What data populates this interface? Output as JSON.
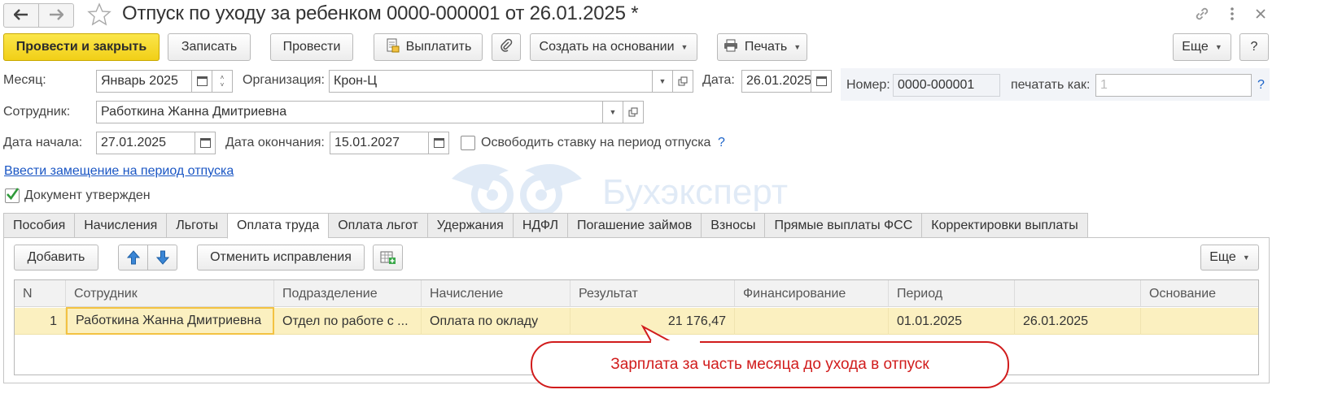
{
  "window": {
    "title": "Отпуск по уходу за ребенком 0000-000001 от 26.01.2025 *",
    "back_icon": "arrow-left-icon",
    "forward_icon": "arrow-right-icon",
    "favorite_icon": "star-icon",
    "link_icon": "link-icon",
    "more_icon": "more-vertical-icon",
    "close_icon": "close-icon"
  },
  "toolbar": {
    "post_close": "Провести и закрыть",
    "save": "Записать",
    "post": "Провести",
    "pay": "Выплатить",
    "create_based": "Создать на основании",
    "print": "Печать",
    "more": "Еще",
    "help": "?"
  },
  "form": {
    "month_label": "Месяц:",
    "month_value": "Январь 2025",
    "org_label": "Организация:",
    "org_value": "Крон-Ц",
    "date_label": "Дата:",
    "date_value": "26.01.2025",
    "number_label": "Номер:",
    "number_value": "0000-000001",
    "print_as_label": "печатать как:",
    "print_as_placeholder": "1",
    "print_as_help": "?",
    "employee_label": "Сотрудник:",
    "employee_value": "Работкина Жанна Дмитриевна",
    "start_label": "Дата начала:",
    "start_value": "27.01.2025",
    "end_label": "Дата окончания:",
    "end_value": "15.01.2027",
    "release_rate_label": "Освободить ставку на период отпуска",
    "release_rate_help": "?",
    "replacement_link": "Ввести замещение на период отпуска",
    "approved_label": "Документ утвержден"
  },
  "watermark": "Бухэксперт",
  "tabs": [
    {
      "label": "Пособия",
      "active": false
    },
    {
      "label": "Начисления",
      "active": false
    },
    {
      "label": "Льготы",
      "active": false
    },
    {
      "label": "Оплата труда",
      "active": true
    },
    {
      "label": "Оплата льгот",
      "active": false
    },
    {
      "label": "Удержания",
      "active": false
    },
    {
      "label": "НДФЛ",
      "active": false
    },
    {
      "label": "Погашение займов",
      "active": false
    },
    {
      "label": "Взносы",
      "active": false
    },
    {
      "label": "Прямые выплаты ФСС",
      "active": false
    },
    {
      "label": "Корректировки выплаты",
      "active": false
    }
  ],
  "tab_toolbar": {
    "add": "Добавить",
    "cancel_corrections": "Отменить исправления",
    "more": "Еще"
  },
  "table": {
    "columns": [
      "N",
      "Сотрудник",
      "Подразделение",
      "Начисление",
      "Результат",
      "Финансирование",
      "Период",
      "",
      "Основание"
    ],
    "rows": [
      {
        "n": "1",
        "employee": "Работкина Жанна Дмитриевна",
        "department": "Отдел по работе с ...",
        "accrual": "Оплата по окладу",
        "result": "21 176,47",
        "financing": "",
        "period_start": "01.01.2025",
        "period_end": "26.01.2025",
        "basis": ""
      }
    ]
  },
  "callout": "Зарплата за часть месяца до ухода в отпуск",
  "colors": {
    "primary_button": "#f3d22a",
    "selected_row": "#fbf0c0",
    "callout": "#d11c1c",
    "link": "#1a56c4"
  }
}
